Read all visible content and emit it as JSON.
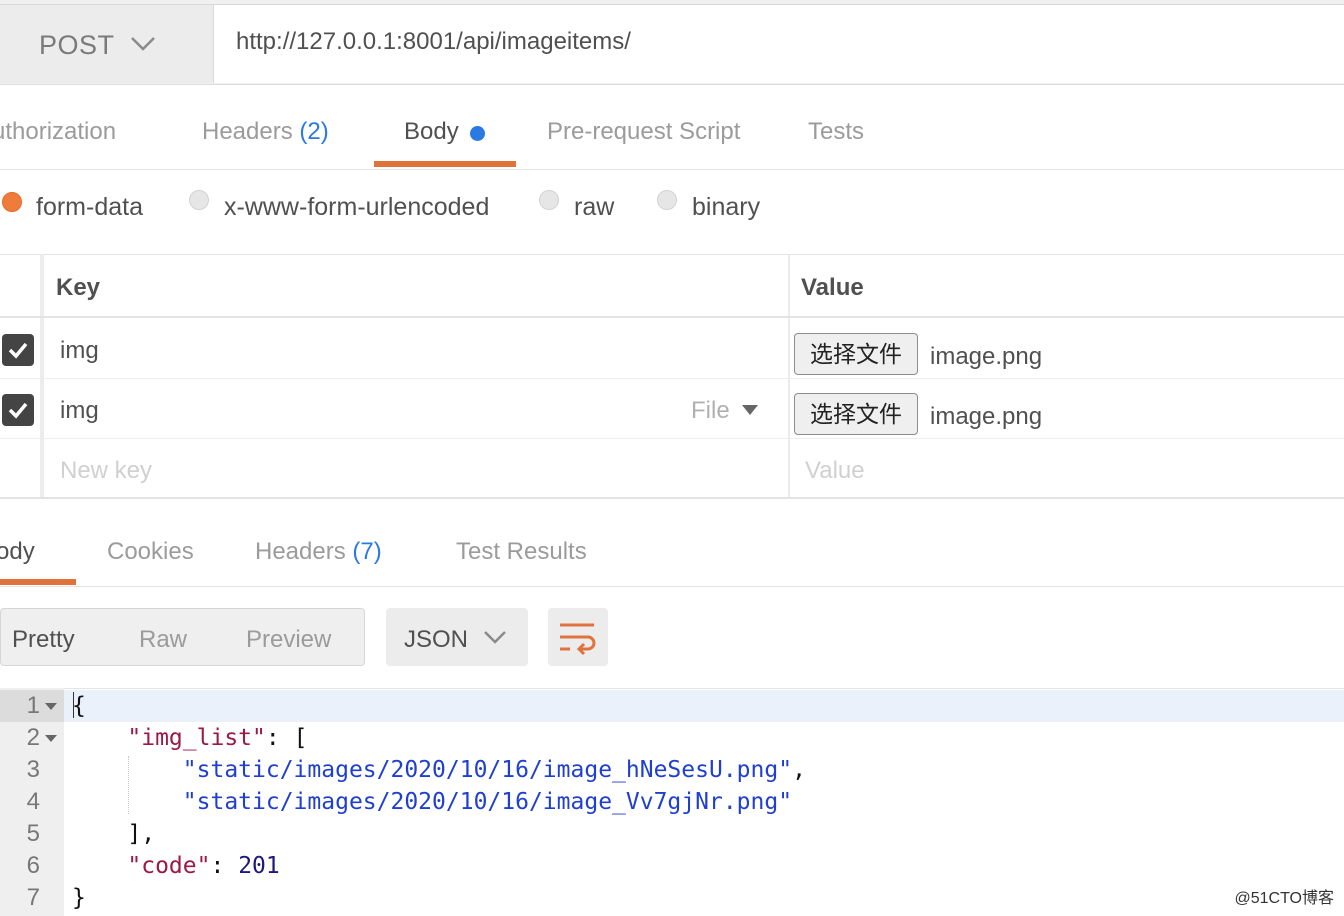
{
  "request": {
    "method": "POST",
    "url": "http://127.0.0.1:8001/api/imageitems/"
  },
  "request_tabs": [
    {
      "label": "uthorization"
    },
    {
      "label": "Headers",
      "count": "(2)"
    },
    {
      "label": "Body",
      "active": true
    },
    {
      "label": "Pre-request Script"
    },
    {
      "label": "Tests"
    }
  ],
  "body_types": [
    {
      "label": "form-data",
      "selected": true
    },
    {
      "label": "x-www-form-urlencoded"
    },
    {
      "label": "raw"
    },
    {
      "label": "binary"
    }
  ],
  "form_table": {
    "headers": {
      "key": "Key",
      "value": "Value"
    },
    "rows": [
      {
        "checked": true,
        "key": "img",
        "file_button": "选择文件",
        "file_name": "image.png"
      },
      {
        "checked": true,
        "key": "img",
        "type": "File",
        "file_button": "选择文件",
        "file_name": "image.png"
      }
    ],
    "new_row": {
      "key_placeholder": "New key",
      "value_placeholder": "Value"
    }
  },
  "response_tabs": [
    {
      "label": "ody",
      "active": true
    },
    {
      "label": "Cookies"
    },
    {
      "label": "Headers",
      "count": "(7)"
    },
    {
      "label": "Test Results"
    }
  ],
  "view_modes": {
    "pretty": "Pretty",
    "raw": "Raw",
    "preview": "Preview",
    "format": "JSON"
  },
  "code_lines": [
    {
      "n": "1",
      "fold": true
    },
    {
      "n": "2",
      "fold": true
    },
    {
      "n": "3"
    },
    {
      "n": "4"
    },
    {
      "n": "5"
    },
    {
      "n": "6"
    },
    {
      "n": "7"
    }
  ],
  "code_tokens": {
    "img_list_key": "\"img_list\"",
    "path1": "\"static/images/2020/10/16/image_hNeSesU.png\"",
    "path2": "\"static/images/2020/10/16/image_Vv7gjNr.png\"",
    "code_key": "\"code\"",
    "code_value": "201"
  },
  "watermark": "@51CTO博客",
  "colors": {
    "accent": "#e0733b",
    "link": "#2a7ae2"
  }
}
